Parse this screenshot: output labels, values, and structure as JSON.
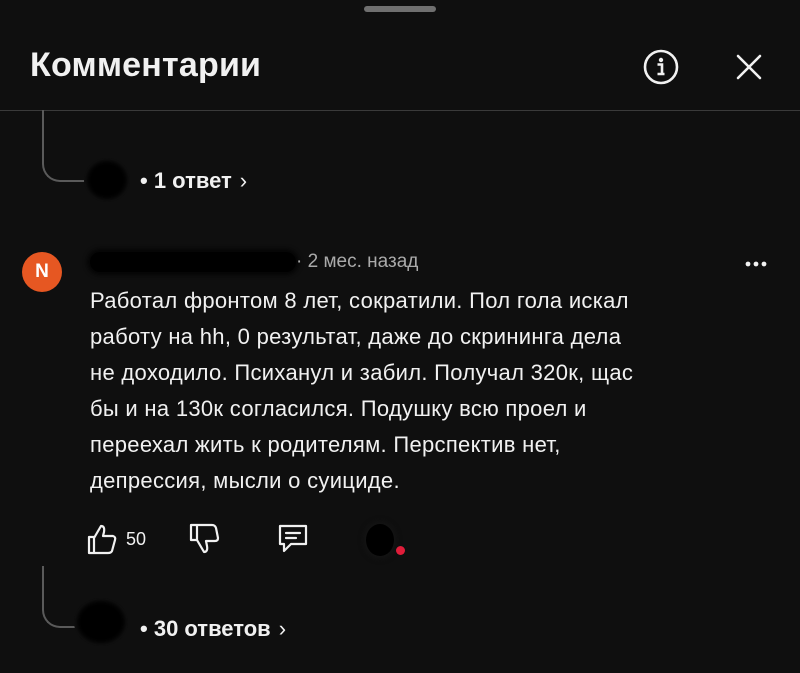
{
  "header": {
    "title": "Комментарии"
  },
  "replies_top": {
    "label": "1 ответ"
  },
  "comment": {
    "avatar_letter": "N",
    "time": "2 мес. назад",
    "text_lines": [
      "Работал фронтом 8 лет, сократили. Пол гола искал",
      "работу на hh, 0 результат, даже до скрининга дела",
      "не доходило. Психанул и забил. Получал 320к, щас",
      "бы и на 130к согласился. Подушку всю проел и",
      "переехал жить к родителям. Перспектив нет,",
      "депрессия, мысли о суициде."
    ],
    "likes": "50"
  },
  "replies_bottom": {
    "label": "30 ответов"
  },
  "colors": {
    "background": "#0f0f0f",
    "avatar": "#e65722",
    "muted": "#aaaaaa"
  },
  "icons": [
    "info-icon",
    "close-icon",
    "more-vert-icon",
    "thumb-up-icon",
    "thumb-down-icon",
    "reply-icon",
    "chevron-right-icon"
  ]
}
